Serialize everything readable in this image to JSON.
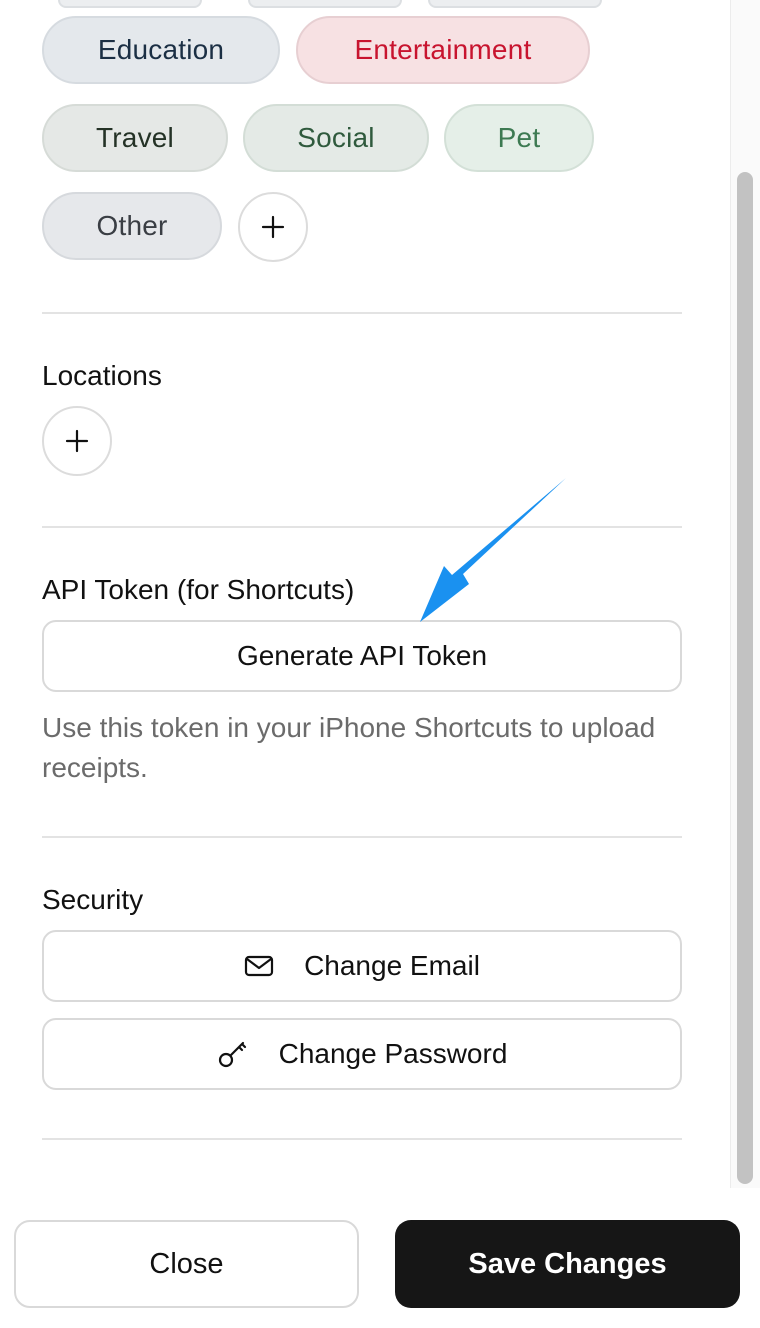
{
  "categories": {
    "tags": [
      {
        "label": "Education",
        "bg": "#e4e8ec",
        "color": "#1b2f44",
        "border": "#d6dbe0"
      },
      {
        "label": "Entertainment",
        "bg": "#f7e1e3",
        "color": "#c8142f",
        "border": "#e7cfd2"
      },
      {
        "label": "Travel",
        "bg": "#e5e8e6",
        "color": "#243226",
        "border": "#d6dbd7"
      },
      {
        "label": "Social",
        "bg": "#e4eae6",
        "color": "#2f5a3d",
        "border": "#d3ddd6"
      },
      {
        "label": "Pet",
        "bg": "#e5efe8",
        "color": "#3d7a52",
        "border": "#d3e0d7"
      },
      {
        "label": "Other",
        "bg": "#e6e8eb",
        "color": "#3a3e44",
        "border": "#d6d9dd"
      }
    ],
    "add_icon": "plus-icon"
  },
  "locations": {
    "title": "Locations",
    "add_icon": "plus-icon"
  },
  "api_token": {
    "title": "API Token (for Shortcuts)",
    "button_label": "Generate API Token",
    "help_text": "Use this token in your iPhone Shortcuts to upload receipts.",
    "annotation_color": "#1a91f0"
  },
  "security": {
    "title": "Security",
    "change_email_label": "Change Email",
    "change_email_icon": "mail-icon",
    "change_password_label": "Change Password",
    "change_password_icon": "key-icon"
  },
  "footer": {
    "close_label": "Close",
    "save_label": "Save Changes"
  }
}
